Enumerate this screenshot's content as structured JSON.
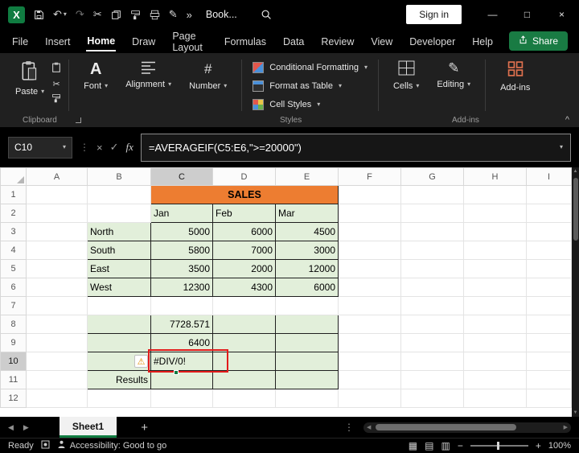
{
  "titlebar": {
    "document_title": "Book...",
    "sign_in_label": "Sign in"
  },
  "menu": {
    "tabs": [
      "File",
      "Insert",
      "Home",
      "Draw",
      "Page Layout",
      "Formulas",
      "Data",
      "Review",
      "View",
      "Developer",
      "Help"
    ],
    "active_tab": "Home",
    "share_label": "Share"
  },
  "ribbon": {
    "paste_label": "Paste",
    "font_label": "Font",
    "alignment_label": "Alignment",
    "number_label": "Number",
    "conditional_formatting_label": "Conditional Formatting",
    "format_as_table_label": "Format as Table",
    "cell_styles_label": "Cell Styles",
    "cells_label": "Cells",
    "editing_label": "Editing",
    "addins_label": "Add-ins",
    "groups": {
      "clipboard": "Clipboard",
      "styles": "Styles",
      "addins": "Add-ins"
    }
  },
  "formula_bar": {
    "name_box": "C10",
    "fx_label": "fx",
    "formula": "=AVERAGEIF(C5:E6,\">=20000\")"
  },
  "grid": {
    "column_headers": [
      "A",
      "B",
      "C",
      "D",
      "E",
      "F",
      "G",
      "H",
      "I"
    ],
    "row_headers": [
      "1",
      "2",
      "3",
      "4",
      "5",
      "6",
      "7",
      "8",
      "9",
      "10",
      "11",
      "12"
    ],
    "selected_cell": "C10",
    "cells": {
      "C1": "SALES",
      "C2": "Jan",
      "D2": "Feb",
      "E2": "Mar",
      "B3": "North",
      "C3": "5000",
      "D3": "6000",
      "E3": "4500",
      "B4": "South",
      "C4": "5800",
      "D4": "7000",
      "E4": "3000",
      "B5": "East",
      "C5": "3500",
      "D5": "2000",
      "E5": "12000",
      "B6": "West",
      "C6": "12300",
      "D6": "4300",
      "E6": "6000",
      "C8": "7728.571",
      "C9": "6400",
      "C10": "#DIV/0!",
      "B11": "Results"
    },
    "colors": {
      "sales_fill": "#ED7D31",
      "table_fill": "#E2EFDA",
      "error_box": "#E21B1B",
      "accent_green": "#107C41"
    }
  },
  "sheet_bar": {
    "sheets": [
      "Sheet1"
    ]
  },
  "status_bar": {
    "mode": "Ready",
    "accessibility": "Accessibility: Good to go",
    "zoom_level": "100%"
  },
  "icons": {
    "undo": "↶",
    "redo": "↷",
    "cut": "✂",
    "pen": "✎",
    "warning": "⚠",
    "dropdown_chevron": "▾",
    "overflow": "»",
    "minimize": "—",
    "maximize": "□",
    "close": "×",
    "cancel": "×",
    "enter": "✓",
    "more_dots": "⋮",
    "nav_left": "◀",
    "nav_right": "▶",
    "scroll_up": "▲",
    "scroll_down": "▼",
    "normal_view": "▦",
    "page_layout_view": "▤",
    "page_break_view": "▥",
    "zoom_out": "−",
    "zoom_in": "+",
    "add_sheet": "+",
    "number": "#",
    "font": "A",
    "collapse": "^"
  }
}
